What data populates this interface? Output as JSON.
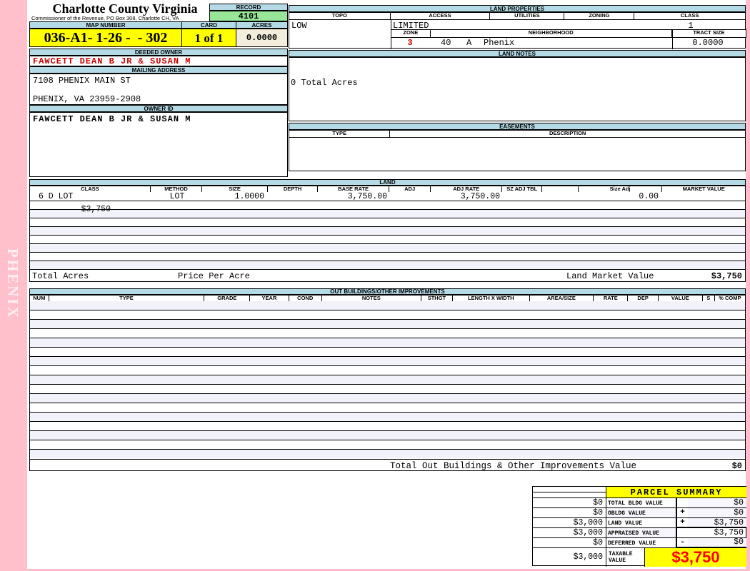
{
  "header": {
    "county": "Charlotte County Virginia",
    "commissioner_line": "Commissioner of the Revenue, PO Box 308, Charlotte CH, VA",
    "record_label": "RECORD",
    "record_value": "4101",
    "map_number_label": "MAP NUMBER",
    "map_number_value": "036-A1- 1-26 -  - 302",
    "card_label": "CARD",
    "card_value": "1 of 1",
    "acres_label": "ACRES",
    "acres_value": "0.0000"
  },
  "owner": {
    "deeded_owner_label": "DEEDED OWNER",
    "deeded_owner": "FAWCETT DEAN B JR & SUSAN M",
    "mailing_address_label": "MAILING ADDRESS",
    "address_line1": "7108 PHENIX MAIN ST",
    "address_line2": "PHENIX, VA 23959-2908",
    "owner_id_label": "OWNER ID",
    "owner_id": "FAWCETT DEAN B JR & SUSAN M"
  },
  "land_properties": {
    "title": "LAND PROPERTIES",
    "topo_label": "TOPO",
    "access_label": "ACCESS",
    "utilities_label": "UTILITIES",
    "zoning_label": "ZONING",
    "class_label": "CLASS",
    "topo": "LOW",
    "access": "LIMITED",
    "class": "1",
    "zone_label": "ZONE",
    "neighborhood_label": "NEIGHBORHOOD",
    "tract_size_label": "TRACT SIZE",
    "zone": "3",
    "neighborhood_code": "40",
    "neighborhood_sub": "A",
    "neighborhood_name": "Phenix",
    "tract_size": "0.0000"
  },
  "land_notes": {
    "title": "LAND NOTES",
    "note": "0 Total Acres"
  },
  "easements": {
    "title": "EASEMENTS",
    "type_label": "TYPE",
    "description_label": "DESCRIPTION"
  },
  "land": {
    "title": "LAND",
    "columns": [
      "CLASS",
      "METHOD",
      "SIZE",
      "DEPTH",
      "BASE RATE",
      "ADJ",
      "ADJ RATE",
      "SZ ADJ TBL",
      "",
      "Size Adj",
      "MARKET VALUE"
    ],
    "rows": [
      {
        "class": "6 D LOT",
        "method": "LOT",
        "size": "1.0000",
        "depth": "",
        "base_rate": "3,750.00",
        "adj": "",
        "adj_rate": "3,750.00",
        "sz_adj_tbl": "",
        "size_adj": "0.00",
        "market_value": "$3,750"
      }
    ],
    "total_acres_label": "Total Acres",
    "price_per_acre_label": "Price Per Acre",
    "land_market_value_label": "Land Market Value",
    "land_market_value": "$3,750"
  },
  "out_buildings": {
    "title": "OUT BUILDINGS/OTHER IMPROVEMENTS",
    "columns": [
      "NUM",
      "TYPE",
      "GRADE",
      "YEAR",
      "COND",
      "NOTES",
      "STHGT",
      "LENGTH X WIDTH",
      "AREA/SIZE",
      "RATE",
      "DEP",
      "VALUE",
      "S",
      "% COMP"
    ],
    "total_label": "Total Out Buildings & Other Improvements Value",
    "total_value": "$0"
  },
  "parcel_summary": {
    "title": "PARCEL SUMMARY",
    "rows": [
      {
        "prior": "$0",
        "label": "TOTAL BLDG VALUE",
        "op": "",
        "value": "$0"
      },
      {
        "prior": "$0",
        "label": "OBLDG VALUE",
        "op": "+",
        "value": "$0"
      },
      {
        "prior": "$3,000",
        "label": "LAND VALUE",
        "op": "+",
        "value": "$3,750"
      },
      {
        "prior": "$3,000",
        "label": "APPRAISED VALUE",
        "op": "",
        "value": "$3,750"
      },
      {
        "prior": "$0",
        "label": "DEFERRED VALUE",
        "op": "-",
        "value": "$0"
      },
      {
        "prior": "$3,000",
        "label": "TAXABLE VALUE",
        "op": "",
        "value": "$3,750"
      }
    ]
  },
  "sidebar": {
    "watermark": "PHENIX"
  },
  "colors": {
    "background_pink": "#FFC0CB",
    "header_bar_blue": "#B4DAE6",
    "record_green": "#98E698",
    "highlight_yellow": "#FFFF00",
    "acres_beige": "#F2EEDB",
    "alt_row_lavender": "#F2F2FA",
    "alert_red": "#CC0000",
    "taxable_red": "#FF0000"
  }
}
